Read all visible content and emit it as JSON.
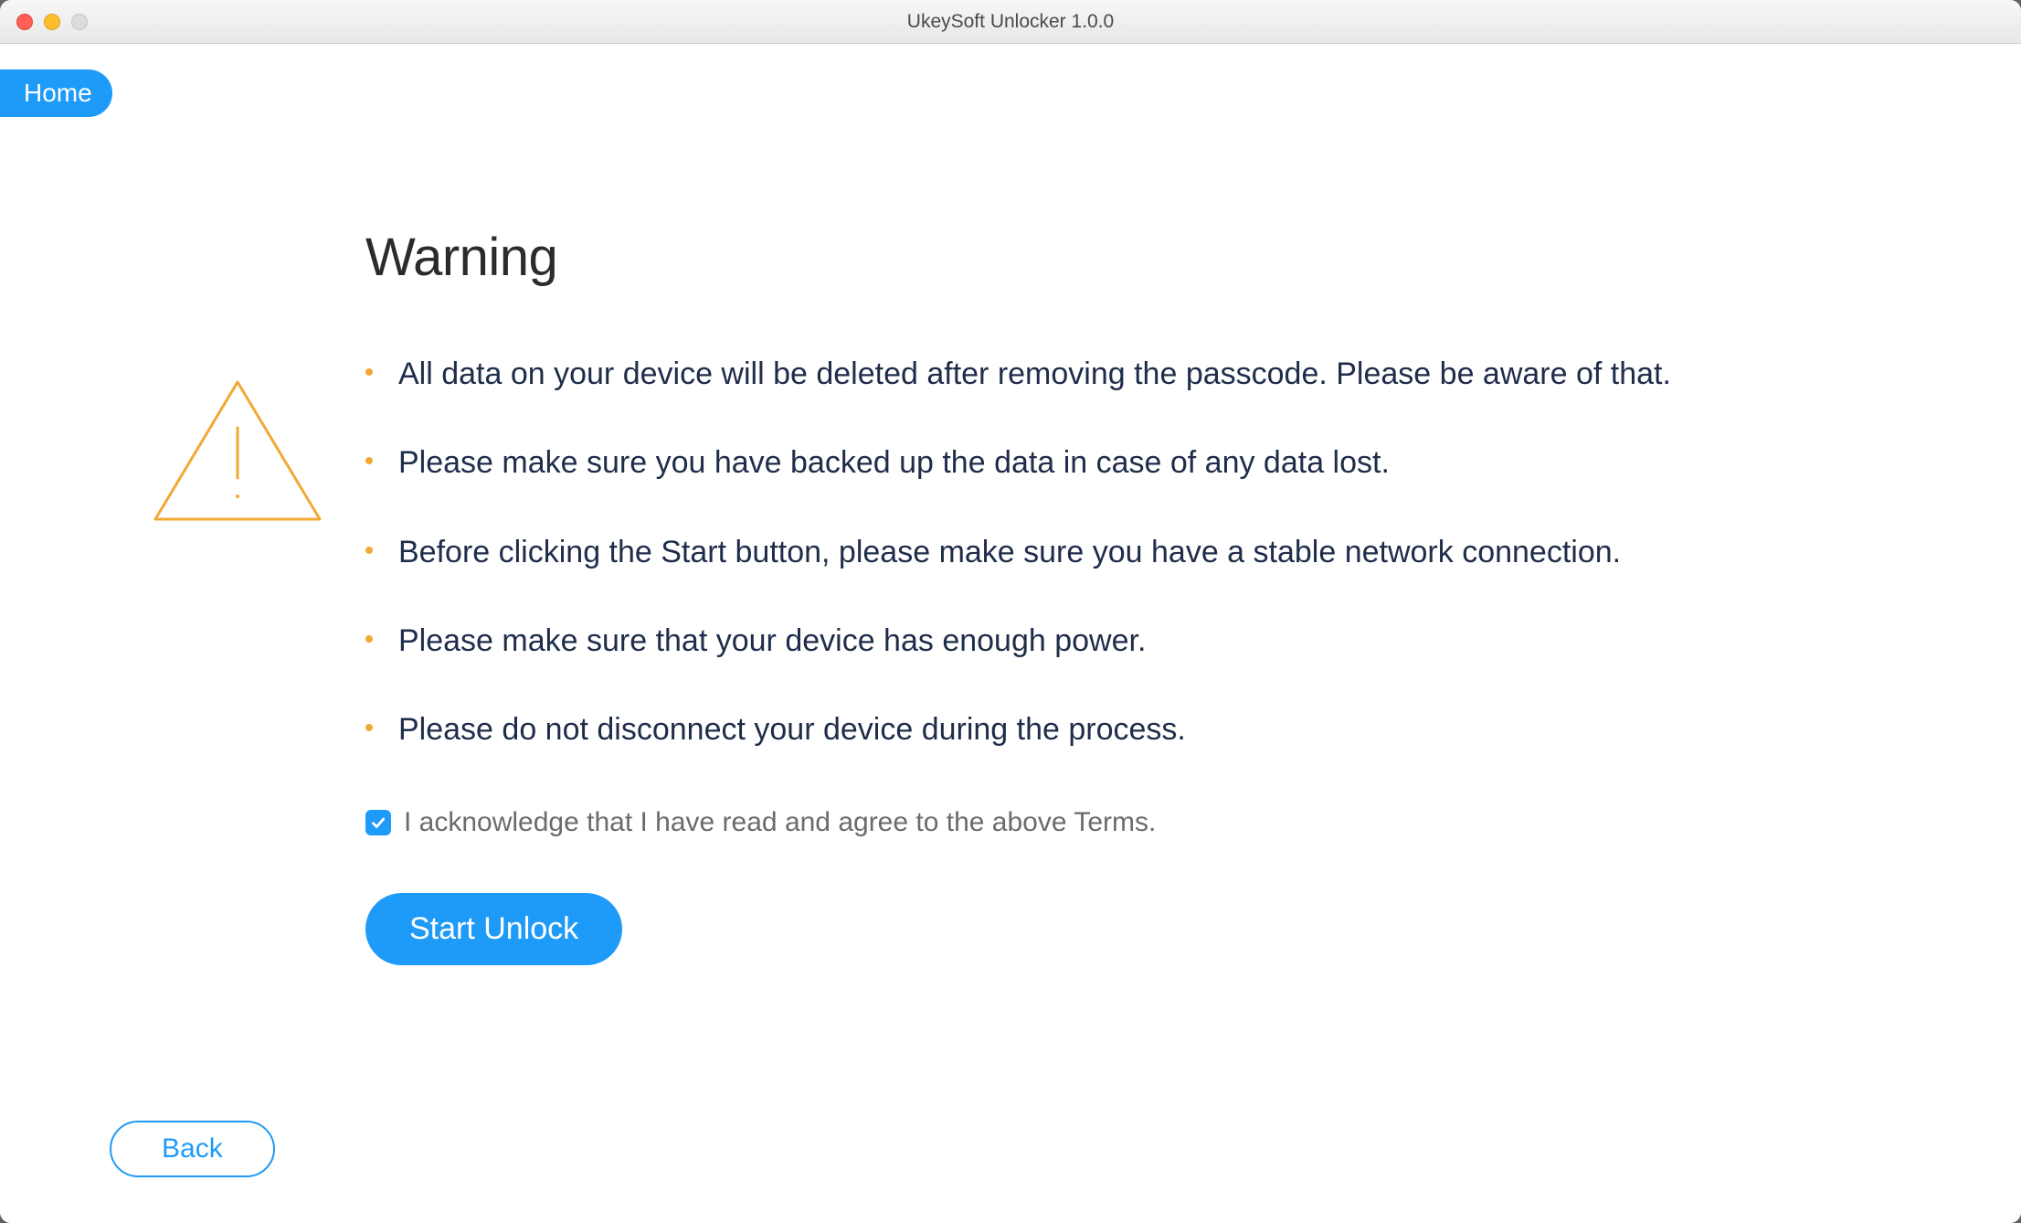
{
  "window": {
    "title": "UkeySoft Unlocker 1.0.0"
  },
  "nav": {
    "home_label": "Home",
    "back_label": "Back"
  },
  "warning": {
    "heading": "Warning",
    "bullets": [
      "All data on your device will be deleted after removing the passcode. Please be aware of that.",
      "Please make sure you have backed up the data in case of any data lost.",
      "Before clicking the Start button, please make sure you have a stable network connection.",
      "Please make sure that your device has enough power.",
      "Please do not disconnect your device during the process."
    ],
    "acknowledge_label": "I acknowledge that I have read and agree to the above Terms.",
    "acknowledge_checked": true,
    "start_button_label": "Start Unlock"
  },
  "colors": {
    "accent": "#1e9bf8",
    "bullet": "#f2a934",
    "body_text": "#1f2d4a"
  }
}
